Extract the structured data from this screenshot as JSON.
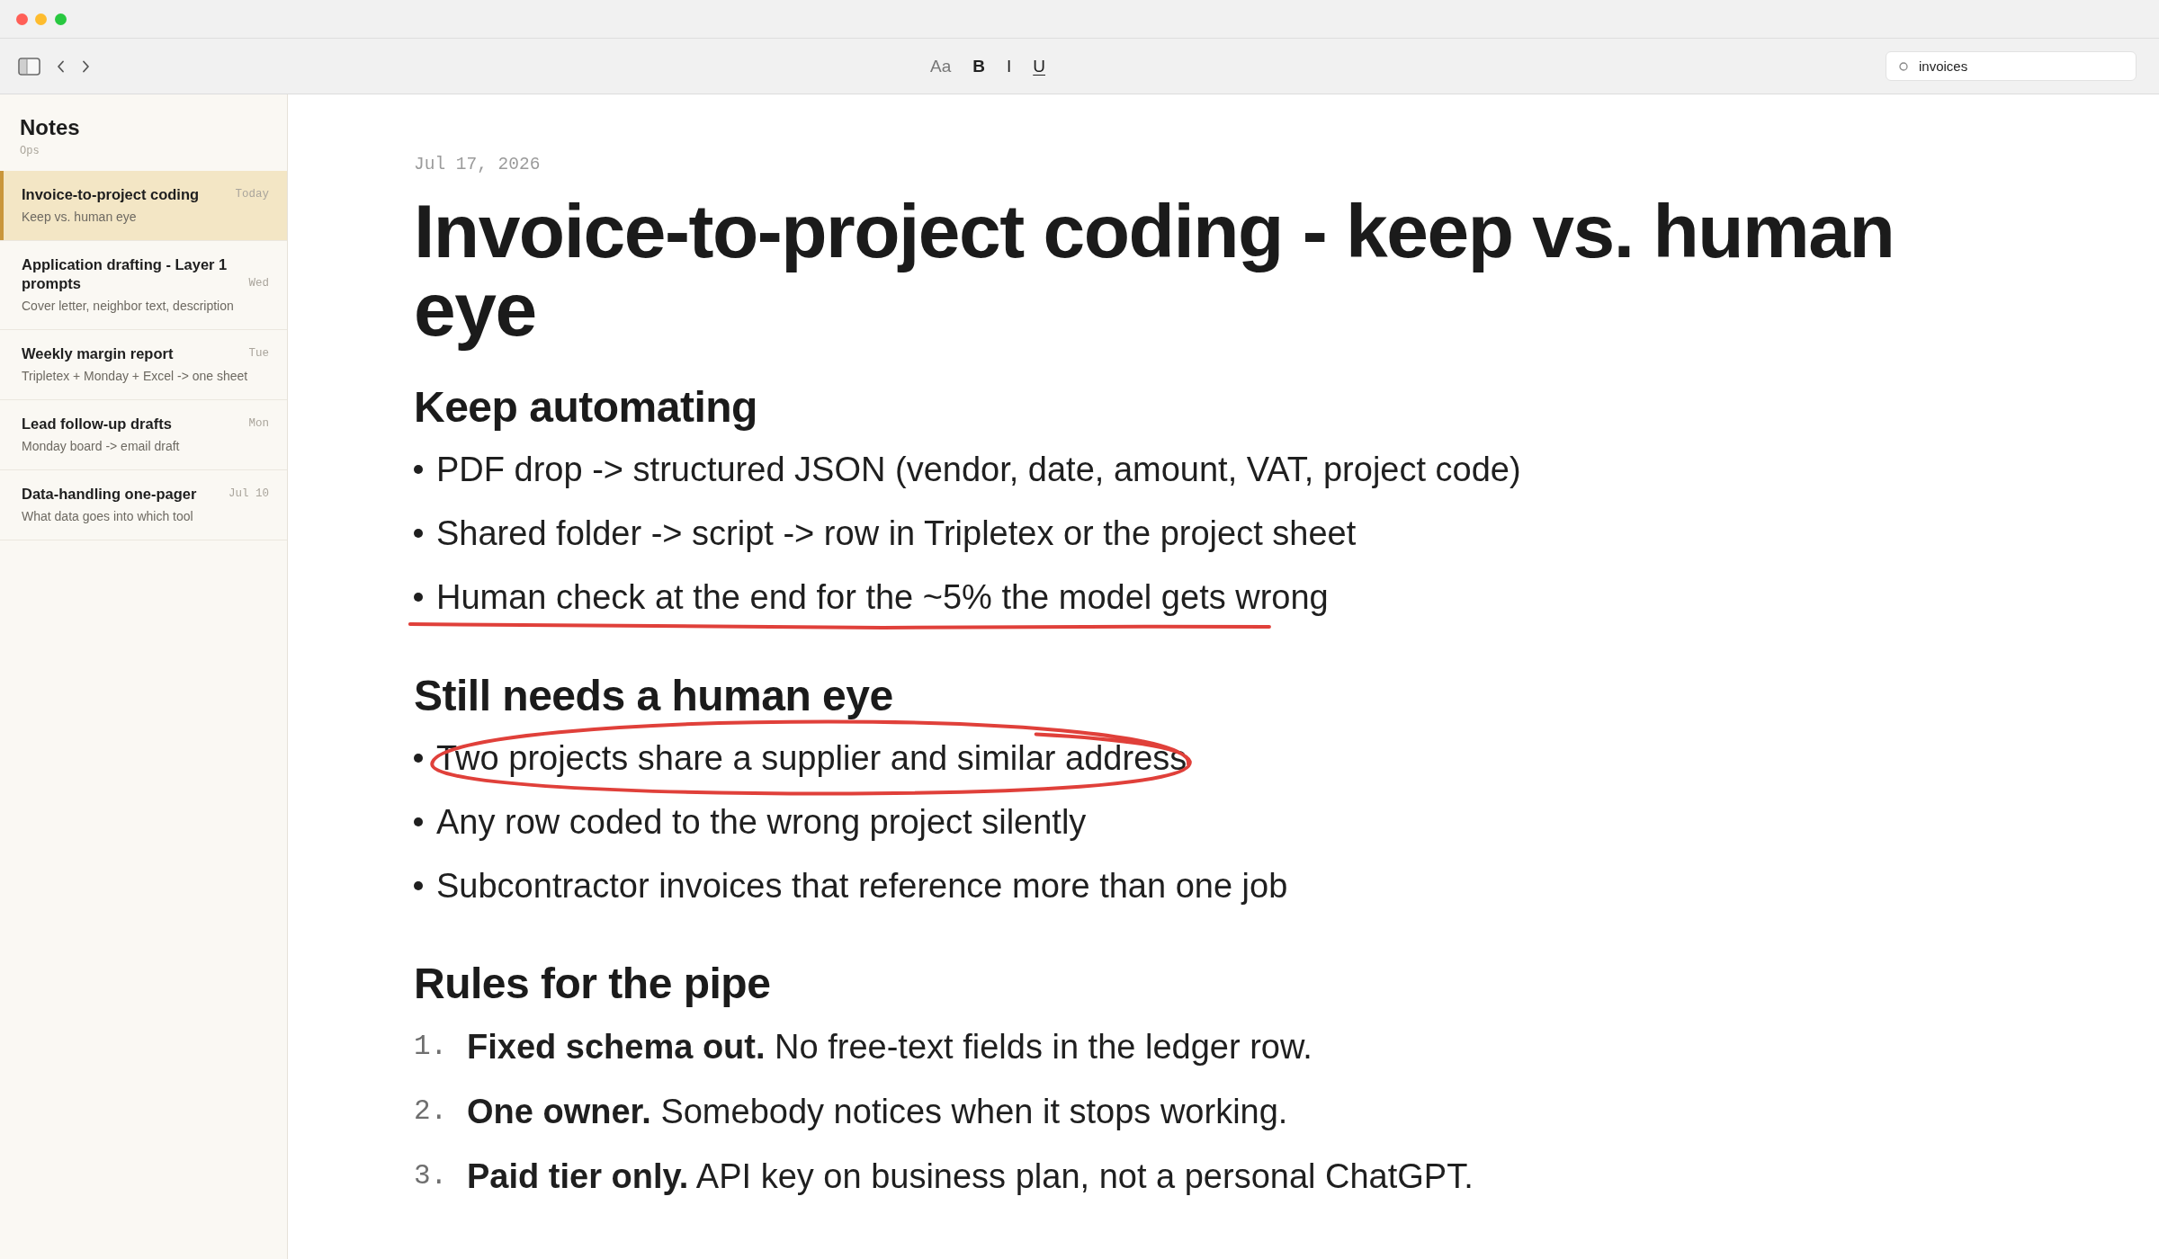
{
  "window": {
    "controls": [
      {
        "color": "#ff5f57"
      },
      {
        "color": "#febc2e"
      },
      {
        "color": "#28c840"
      }
    ]
  },
  "toolbar": {
    "format_buttons": [
      {
        "label": "Aa",
        "kind": "font"
      },
      {
        "label": "B",
        "kind": "bold"
      },
      {
        "label": "I",
        "kind": "italic"
      },
      {
        "label": "U",
        "kind": "underline"
      }
    ],
    "search": {
      "value": "invoices"
    }
  },
  "sidebar": {
    "title": "Notes",
    "subtitle": "Ops",
    "items": [
      {
        "title": "Invoice-to-project coding",
        "preview": "Keep vs. human eye",
        "date": "Today",
        "selected": true
      },
      {
        "title": "Application drafting - Layer 1 prompts",
        "preview": "Cover letter, neighbor text, description",
        "date": "Wed",
        "selected": false
      },
      {
        "title": "Weekly margin report",
        "preview": "Tripletex + Monday + Excel -> one sheet",
        "date": "Tue",
        "selected": false
      },
      {
        "title": "Lead follow-up drafts",
        "preview": "Monday board -> email draft",
        "date": "Mon",
        "selected": false
      },
      {
        "title": "Data-handling one-pager",
        "preview": "What data goes into which tool",
        "date": "Jul 10",
        "selected": false
      }
    ]
  },
  "note": {
    "date": "Jul 17, 2026",
    "title": "Invoice-to-project coding - keep vs. human eye",
    "sections": [
      {
        "heading": "Keep automating",
        "kind": "bullets",
        "items": [
          {
            "text": "PDF drop -> structured JSON (vendor, date, amount, VAT, project code)",
            "underlined": false,
            "circled": false
          },
          {
            "text": "Shared folder -> script -> row in Tripletex or the project sheet",
            "underlined": false,
            "circled": false
          },
          {
            "text": "Human check at the end for the ~5% the model gets wrong",
            "underlined": true,
            "circled": false
          }
        ]
      },
      {
        "heading": "Still needs a human eye",
        "kind": "bullets",
        "items": [
          {
            "text": "Two projects share a supplier and similar address",
            "underlined": false,
            "circled": true
          },
          {
            "text": "Any row coded to the wrong project silently",
            "underlined": false,
            "circled": false
          },
          {
            "text": "Subcontractor invoices that reference more than one job",
            "underlined": false,
            "circled": false
          }
        ]
      },
      {
        "heading": "Rules for the pipe",
        "kind": "numbered",
        "items": [
          {
            "number": "1.",
            "text": "**Fixed schema out.** No free-text fields in the ledger row."
          },
          {
            "number": "2.",
            "text": "**One owner.** Somebody notices when it stops working."
          },
          {
            "number": "3.",
            "text": "**Paid tier only.** API key on business plan, not a personal ChatGPT."
          }
        ]
      }
    ]
  }
}
